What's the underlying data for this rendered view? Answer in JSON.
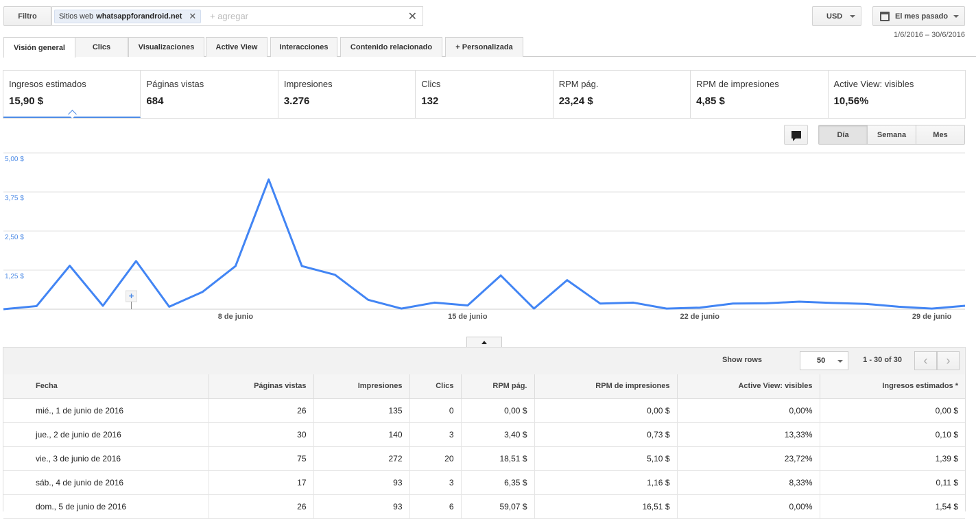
{
  "filter": {
    "label": "Filtro",
    "chip_prefix": "Sitios web",
    "chip_value": "whatsappforandroid.net",
    "add_placeholder": "+ agregar"
  },
  "currency": "USD",
  "period": {
    "label": "El mes pasado",
    "range": "1/6/2016 – 30/6/2016"
  },
  "tabs": [
    "Visión general",
    "Clics",
    "Visualizaciones",
    "Active View",
    "Interacciones",
    "Contenido relacionado",
    "+ Personalizada"
  ],
  "scorecards": [
    {
      "label": "Ingresos estimados",
      "value": "15,90 $"
    },
    {
      "label": "Páginas vistas",
      "value": "684"
    },
    {
      "label": "Impresiones",
      "value": "3.276"
    },
    {
      "label": "Clics",
      "value": "132"
    },
    {
      "label": "RPM pág.",
      "value": "23,24 $"
    },
    {
      "label": "RPM de impresiones",
      "value": "4,85 $"
    },
    {
      "label": "Active View: visibles",
      "value": "10,56%"
    }
  ],
  "granularity": [
    "Día",
    "Semana",
    "Mes"
  ],
  "chart_data": {
    "type": "line",
    "y_tick_labels": [
      "5,00 $",
      "3,75 $",
      "2,50 $",
      "1,25 $"
    ],
    "y_ticks": [
      5.0,
      3.75,
      2.5,
      1.25
    ],
    "ylim": [
      0,
      5
    ],
    "x_tick_labels": [
      "8 de junio",
      "15 de junio",
      "22 de junio",
      "29 de junio"
    ],
    "x_tick_days": [
      8,
      15,
      22,
      29
    ],
    "series": [
      {
        "color": "#4285f4",
        "x": [
          1,
          2,
          3,
          4,
          5,
          6,
          7,
          8,
          9,
          10,
          11,
          12,
          13,
          14,
          15,
          16,
          17,
          18,
          19,
          20,
          21,
          22,
          23,
          24,
          25,
          26,
          27,
          28,
          29,
          30
        ],
        "values": [
          0.0,
          0.1,
          1.39,
          0.11,
          1.54,
          0.08,
          0.55,
          1.38,
          4.15,
          1.38,
          1.1,
          0.3,
          0.02,
          0.21,
          0.12,
          1.08,
          0.02,
          0.93,
          0.18,
          0.21,
          0.02,
          0.05,
          0.18,
          0.19,
          0.24,
          0.2,
          0.17,
          0.08,
          0.02,
          0.11
        ]
      }
    ],
    "grid": true
  },
  "table": {
    "show_rows_label": "Show rows",
    "rows_value": "50",
    "pager": "1 - 30 of 30",
    "headers": [
      "Fecha",
      "Páginas vistas",
      "Impresiones",
      "Clics",
      "RPM pág.",
      "RPM de impresiones",
      "Active View: visibles",
      "Ingresos estimados *"
    ],
    "rows": [
      [
        "mié., 1 de junio de 2016",
        "26",
        "135",
        "0",
        "0,00 $",
        "0,00 $",
        "0,00%",
        "0,00 $"
      ],
      [
        "jue., 2 de junio de 2016",
        "30",
        "140",
        "3",
        "3,40 $",
        "0,73 $",
        "13,33%",
        "0,10 $"
      ],
      [
        "vie., 3 de junio de 2016",
        "75",
        "272",
        "20",
        "18,51 $",
        "5,10 $",
        "23,72%",
        "1,39 $"
      ],
      [
        "sáb., 4 de junio de 2016",
        "17",
        "93",
        "3",
        "6,35 $",
        "1,16 $",
        "8,33%",
        "0,11 $"
      ],
      [
        "dom., 5 de junio de 2016",
        "26",
        "93",
        "6",
        "59,07 $",
        "16,51 $",
        "0,00%",
        "1,54 $"
      ]
    ]
  }
}
